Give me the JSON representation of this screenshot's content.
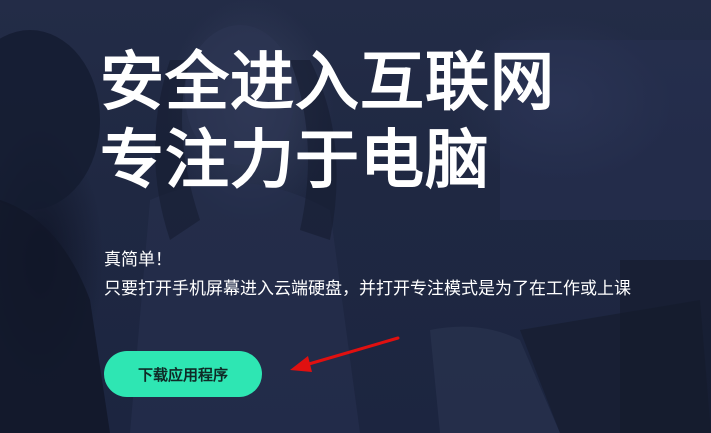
{
  "hero": {
    "headline_line1": "安全进入互联网",
    "headline_line2": "专注力于电脑",
    "desc_line1": "真简单！",
    "desc_line2": "只要打开手机屏幕进入云端硬盘，并打开专注模式是为了在工作或上课",
    "download_button_label": "下载应用程序"
  },
  "colors": {
    "background": "#1e2740",
    "accent_button": "#2ee6b3",
    "annotation_arrow": "#e01010"
  },
  "annotation": {
    "icon": "red-arrow-icon"
  }
}
